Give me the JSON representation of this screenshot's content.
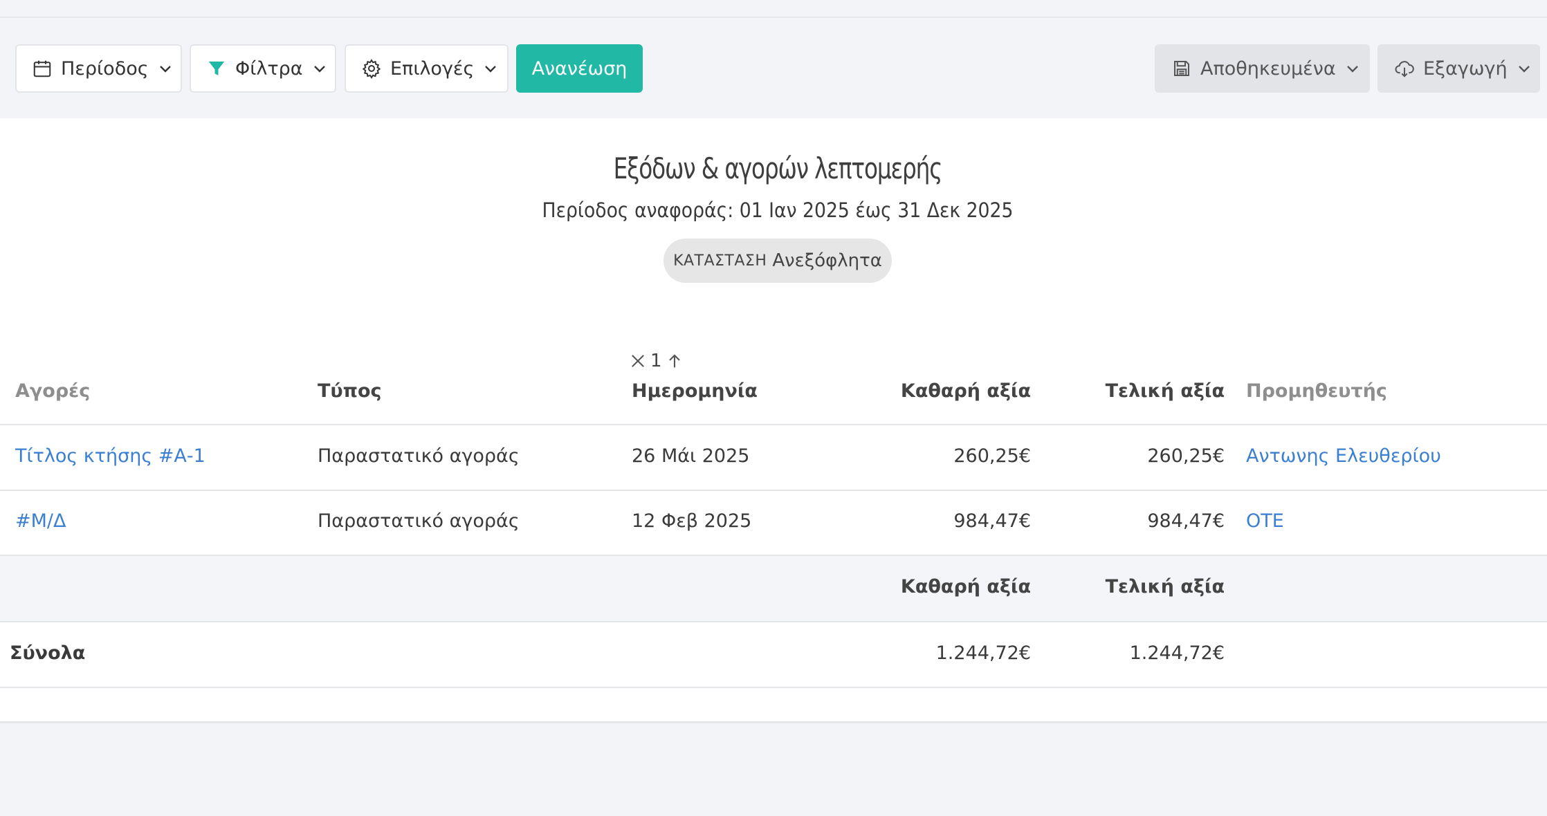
{
  "toolbar": {
    "period_label": "Περίοδος",
    "filters_label": "Φίλτρα",
    "options_label": "Επιλογές",
    "refresh_label": "Ανανέωση",
    "saved_label": "Αποθηκευμένα",
    "export_label": "Εξαγωγή"
  },
  "report": {
    "title": "Εξόδων & αγορών λεπτομερής",
    "period_text": "Περίοδος αναφοράς: 01 Ιαν 2025 έως 31 Δεκ 2025",
    "status_key": "ΚΑΤΑΣΤΑΣΗ",
    "status_value": "Ανεξόφλητα",
    "sort_index": "1"
  },
  "table": {
    "headers": {
      "purchases": "Αγορές",
      "type": "Τύπος",
      "date": "Ημερομηνία",
      "net": "Καθαρή αξία",
      "final": "Τελική αξία",
      "supplier": "Προμηθευτής"
    },
    "rows": [
      {
        "purchase": "Τίτλος κτήσης #Α-1",
        "type": "Παραστατικό αγοράς",
        "date": "26 Μάι 2025",
        "net": "260,25€",
        "final": "260,25€",
        "supplier": "Αντωνης Ελευθερίου"
      },
      {
        "purchase": "#Μ/Δ",
        "type": "Παραστατικό αγοράς",
        "date": "12 Φεβ 2025",
        "net": "984,47€",
        "final": "984,47€",
        "supplier": "ΟΤΕ"
      }
    ],
    "totals": {
      "net_header": "Καθαρή αξία",
      "final_header": "Τελική αξία",
      "label": "Σύνολα",
      "net": "1.244,72€",
      "final": "1.244,72€"
    }
  },
  "colors": {
    "accent": "#22b8a6",
    "link": "#3b7fd0",
    "background": "#f3f4f7"
  }
}
